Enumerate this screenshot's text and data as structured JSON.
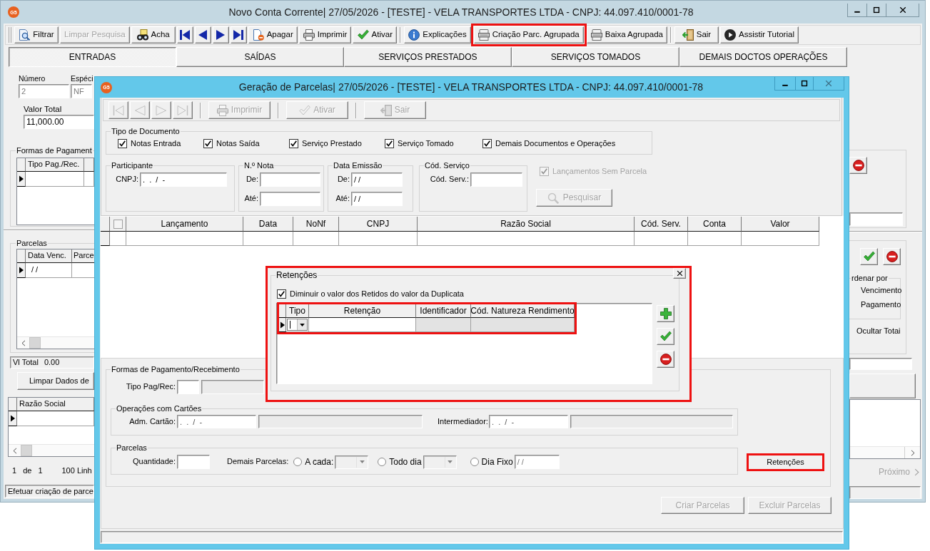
{
  "main_window": {
    "logo": "G5",
    "title": "Novo Conta Corrente|  27/05/2026 - [TESTE] - VELA TRANSPORTES LTDA - CNPJ: 44.097.410/0001-78",
    "toolbar": [
      [
        {
          "kind": "button",
          "label": "Filtrar",
          "disabled": false,
          "highlighted": false
        },
        {
          "kind": "button",
          "label": "Limpar Pesquisa",
          "disabled": true,
          "highlighted": false
        },
        {
          "kind": "button",
          "label": "Acha",
          "disabled": false,
          "highlighted": false
        },
        {
          "kind": "nav",
          "disabled": false,
          "highlighted": false
        },
        {
          "kind": "nav",
          "disabled": false,
          "highlighted": false
        },
        {
          "kind": "nav",
          "disabled": false,
          "highlighted": false
        },
        {
          "kind": "nav",
          "disabled": false,
          "highlighted": false
        },
        {
          "kind": "button",
          "label": "Apagar",
          "disabled": false,
          "highlighted": false
        },
        {
          "kind": "button",
          "label": "Imprimir",
          "disabled": false,
          "highlighted": false
        },
        {
          "kind": "button",
          "label": "Ativar",
          "disabled": false,
          "highlighted": false
        }
      ],
      [
        {
          "kind": "button",
          "label": "Explicações",
          "disabled": false,
          "highlighted": false
        },
        {
          "kind": "button",
          "label": "Criação Parc. Agrupada",
          "disabled": false,
          "highlighted": true
        },
        {
          "kind": "button",
          "label": "Baixa Agrupada",
          "disabled": false,
          "highlighted": false
        }
      ],
      [
        {
          "kind": "button",
          "label": "Sair",
          "disabled": false,
          "highlighted": false
        },
        {
          "kind": "button",
          "label": "Assistir Tutorial",
          "disabled": false,
          "highlighted": false
        }
      ]
    ],
    "tabs": [
      {
        "label": "ENTRADAS",
        "selected": true
      },
      {
        "label": "SAÍDAS",
        "selected": false
      },
      {
        "label": "SERVIÇOS PRESTADOS",
        "selected": false
      },
      {
        "label": "SERVIÇOS TOMADOS",
        "selected": false
      },
      {
        "label": "DEMAIS DOCTOS OPERAÇÕES",
        "selected": false
      }
    ],
    "form": {
      "numero": {
        "label": "Número",
        "value": "2",
        "disabled": true
      },
      "especie": {
        "label": "Espéci",
        "value": "NF",
        "disabled": true
      },
      "valor_total": {
        "label": "Valor Total",
        "value": "11,000.00",
        "disabled": false
      }
    },
    "formas_pagamento": {
      "title": "Formas de Pagament",
      "columns": [
        "Tipo Pag./Rec."
      ]
    },
    "parcelas": {
      "title": "Parcelas",
      "columns": [
        "Data Venc.",
        "Parce"
      ],
      "rows": [
        [
          "/ /"
        ]
      ]
    },
    "vl_total": {
      "label": "Vl Total",
      "value": "0.00"
    },
    "limpar_button": "Limpar Dados de",
    "lista": {
      "columns": [
        "Razão Social"
      ]
    },
    "pager": {
      "current": "1",
      "of": "de",
      "total": "1",
      "lines": "100 Linh"
    },
    "ordenar_por": {
      "title": "rdenar por",
      "options": [
        "Vencimento",
        "Pagamento"
      ]
    },
    "ocultar_totais": "Ocultar Totai",
    "next_page": {
      "label": "Próximo",
      "disabled": true
    },
    "status_bar": "Efetuar criação de parce"
  },
  "dialog": {
    "logo": "G5",
    "title": "Geração de Parcelas|  27/05/2026 - [TESTE] - VELA TRANSPORTES LTDA - CNPJ: 44.097.410/0001-78",
    "toolbar": [
      [
        {
          "kind": "nav",
          "disabled": true
        },
        {
          "kind": "nav",
          "disabled": true
        },
        {
          "kind": "nav",
          "disabled": true
        },
        {
          "kind": "nav",
          "disabled": true
        }
      ],
      [
        {
          "kind": "button",
          "label": "Imprimir",
          "disabled": true
        }
      ],
      [
        {
          "kind": "button",
          "label": "Ativar",
          "disabled": true
        }
      ],
      [
        {
          "kind": "button",
          "label": "Sair",
          "disabled": true
        }
      ]
    ],
    "tipo_documento": {
      "title": "Tipo de Documento",
      "options": [
        {
          "label": "Notas Entrada",
          "checked": true
        },
        {
          "label": "Notas Saída",
          "checked": true
        },
        {
          "label": "Serviço Prestado",
          "checked": true
        },
        {
          "label": "Serviço Tomado",
          "checked": true
        },
        {
          "label": "Demais Documentos e Operações",
          "checked": true
        }
      ]
    },
    "filters": [
      {
        "title": "Participante",
        "fields": [
          {
            "label": "CNPJ:",
            "value": ".  .  /  -"
          }
        ]
      },
      {
        "title": "N.º Nota",
        "fields": [
          {
            "label": "De:"
          },
          {
            "label": "Até:"
          }
        ]
      },
      {
        "title": "Data Emissão",
        "fields": [
          {
            "label": "De:",
            "value": "/ /"
          },
          {
            "label": "Até:",
            "value": "/ /"
          }
        ]
      },
      {
        "title": "Cód. Serviço",
        "fields": [
          {
            "label": "Cód. Serv.:"
          }
        ]
      }
    ],
    "lancamentos_sem_parcela": {
      "label": "Lançamentos Sem Parcela",
      "checked": true,
      "disabled": true
    },
    "pesquisar_button": {
      "label": "Pesquisar",
      "disabled": true
    },
    "grid": {
      "select_all": {
        "checked": false
      },
      "columns": [
        "Lançamento",
        "Data",
        "NoNf",
        "CNPJ",
        "Razão Social",
        "Cód. Serv.",
        "Conta",
        "Valor"
      ]
    },
    "formas_pagamento": {
      "title": "Formas de Pagamento/Recebimento",
      "tipo_pag_rec": {
        "label": "Tipo Pag/Rec:"
      },
      "cartoes": {
        "title": "Operações com Cartões",
        "fields": [
          {
            "label": "Adm. Cartão:",
            "value": ".  .  /  -"
          },
          {
            "label": "Intermediador:",
            "value": ".  .  /  -"
          }
        ]
      },
      "parcelas": {
        "title": "Parcelas",
        "quantidade": {
          "label": "Quantidade:"
        },
        "demais_parcelas": {
          "label": "Demais Parcelas:",
          "options": [
            {
              "kind": "combo",
              "label": "A cada:",
              "selected": false,
              "disabled": true
            },
            {
              "kind": "combo",
              "label": "Todo dia",
              "selected": false,
              "disabled": true
            },
            {
              "kind": "date",
              "label": "Dia Fixo",
              "selected": false,
              "disabled": true,
              "value": "/ /"
            }
          ]
        }
      },
      "retencoes_button": {
        "label": "Retenções",
        "highlighted": true
      }
    },
    "actions": [
      {
        "label": "Criar Parcelas",
        "disabled": true
      },
      {
        "label": "Excluir Parcelas",
        "disabled": true
      }
    ]
  },
  "retencoes_popup": {
    "title": "Retenções",
    "highlighted": true,
    "deduct": {
      "label": "Diminuir o valor dos Retidos do valor da Duplicata",
      "checked": true
    },
    "grid": {
      "highlighted": true,
      "columns": [
        "Tipo",
        "Retenção",
        "Identificador",
        "Cód. Natureza Rendimento"
      ]
    }
  }
}
